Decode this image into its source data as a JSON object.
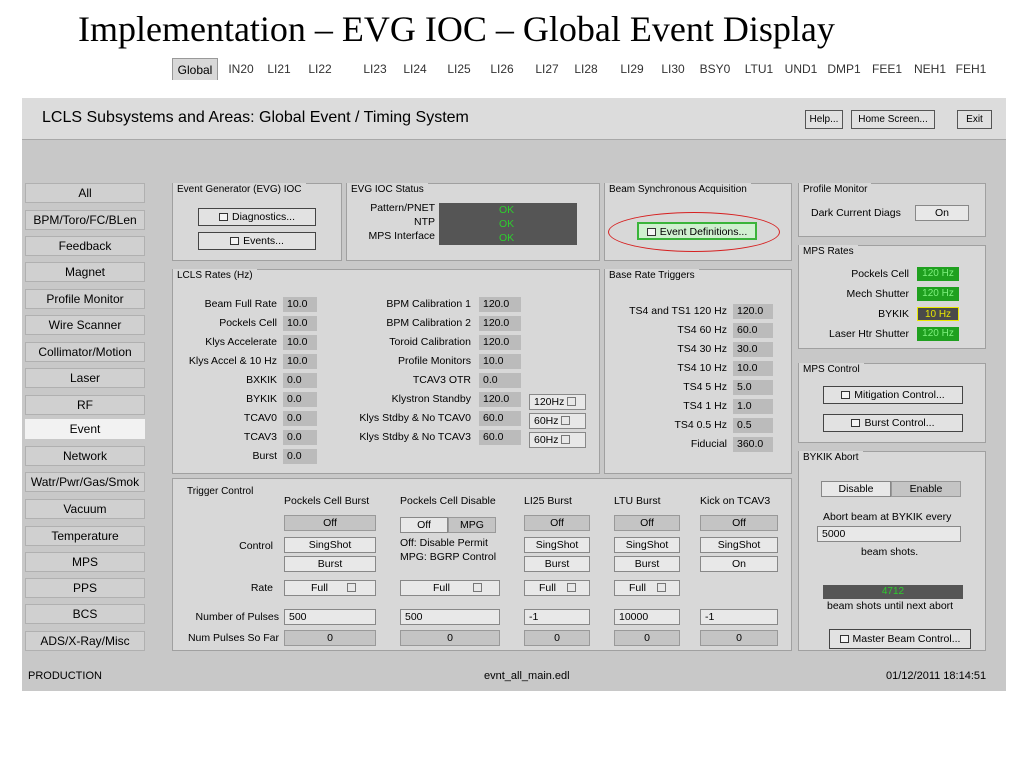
{
  "slide": {
    "title": "Implementation – EVG IOC – Global Event Display"
  },
  "app": {
    "title": "LCLS Subsystems and Areas: Global Event / Timing System",
    "help": "Help...",
    "home": "Home Screen...",
    "exit": "Exit"
  },
  "tabs": [
    "Global",
    "IN20",
    "LI21",
    "LI22",
    "LI23",
    "LI24",
    "LI25",
    "LI26",
    "LI27",
    "LI28",
    "LI29",
    "LI30",
    "BSY0",
    "LTU1",
    "UND1",
    "DMP1",
    "FEE1",
    "NEH1",
    "FEH1"
  ],
  "nav": [
    "All",
    "BPM/Toro/FC/BLen",
    "Feedback",
    "Magnet",
    "Profile Monitor",
    "Wire Scanner",
    "Collimator/Motion",
    "Laser",
    "RF",
    "Event",
    "Network",
    "Watr/Pwr/Gas/Smok",
    "Vacuum",
    "Temperature",
    "MPS",
    "PPS",
    "BCS",
    "ADS/X-Ray/Misc"
  ],
  "evg": {
    "title": "Event Generator (EVG) IOC",
    "diagnostics": "Diagnostics...",
    "events": "Events..."
  },
  "evg_status": {
    "title": "EVG IOC Status",
    "pattern_label": "Pattern/PNET",
    "pattern_val": "OK",
    "ntp_label": "NTP",
    "ntp_val": "OK",
    "mps_label": "MPS Interface",
    "mps_val": "OK"
  },
  "bsa": {
    "title": "Beam Synchronous Acquisition",
    "event_def": "Event Definitions..."
  },
  "rates": {
    "title": "LCLS Rates (Hz)",
    "left": [
      {
        "label": "Beam Full Rate",
        "value": "10.0"
      },
      {
        "label": "Pockels Cell",
        "value": "10.0"
      },
      {
        "label": "Klys Accelerate",
        "value": "10.0"
      },
      {
        "label": "Klys Accel & 10 Hz",
        "value": "10.0"
      },
      {
        "label": "BXKIK",
        "value": "0.0"
      },
      {
        "label": "BYKIK",
        "value": "0.0"
      },
      {
        "label": "TCAV0",
        "value": "0.0"
      },
      {
        "label": "TCAV3",
        "value": "0.0"
      },
      {
        "label": "Burst",
        "value": "0.0"
      }
    ],
    "right": [
      {
        "label": "BPM Calibration 1",
        "value": "120.0"
      },
      {
        "label": "BPM Calibration 2",
        "value": "120.0"
      },
      {
        "label": "Toroid Calibration",
        "value": "120.0"
      },
      {
        "label": "Profile Monitors",
        "value": "10.0"
      },
      {
        "label": "TCAV3 OTR",
        "value": "0.0"
      },
      {
        "label": "Klystron Standby",
        "value": "120.0"
      },
      {
        "label": "Klys Stdby & No TCAV0",
        "value": "60.0"
      },
      {
        "label": "Klys Stdby & No TCAV3",
        "value": "60.0"
      }
    ],
    "menus": [
      "120Hz",
      "60Hz",
      "60Hz"
    ]
  },
  "base": {
    "title": "Base Rate Triggers",
    "rows": [
      {
        "label": "TS4 and TS1 120 Hz",
        "value": "120.0"
      },
      {
        "label": "TS4 60 Hz",
        "value": "60.0"
      },
      {
        "label": "TS4 30 Hz",
        "value": "30.0"
      },
      {
        "label": "TS4 10 Hz",
        "value": "10.0"
      },
      {
        "label": "TS4 5 Hz",
        "value": "5.0"
      },
      {
        "label": "TS4 1 Hz",
        "value": "1.0"
      },
      {
        "label": "TS4 0.5 Hz",
        "value": "0.5"
      },
      {
        "label": "Fiducial",
        "value": "360.0"
      }
    ]
  },
  "trig": {
    "title": "Trigger Control",
    "cols": [
      "Pockels Cell Burst",
      "Pockels Cell Disable",
      "LI25 Burst",
      "LTU Burst",
      "Kick on TCAV3"
    ],
    "control_label": "Control",
    "rate_label": "Rate",
    "npulse_label": "Number of Pulses",
    "sofar_label": "Num Pulses So Far",
    "off": "Off",
    "mpg": "MPG",
    "singshot": "SingShot",
    "burst": "Burst",
    "on": "On",
    "full": "Full",
    "disable1": "Off: Disable Permit",
    "disable2": "MPG: BGRP Control",
    "npulses": [
      "500",
      "500",
      "-1",
      "10000",
      "-1"
    ],
    "sofar": [
      "0",
      "0",
      "0",
      "0",
      "0"
    ]
  },
  "profile": {
    "title": "Profile Monitor",
    "dark_label": "Dark Current Diags",
    "dark_val": "On"
  },
  "mps_rates": {
    "title": "MPS Rates",
    "rows": [
      {
        "label": "Pockels Cell",
        "value": "120 Hz"
      },
      {
        "label": "Mech Shutter",
        "value": "120 Hz"
      },
      {
        "label": "BYKIK",
        "value": "10 Hz"
      },
      {
        "label": "Laser Htr Shutter",
        "value": "120 Hz"
      }
    ]
  },
  "mps_ctrl": {
    "title": "MPS Control",
    "mitigation": "Mitigation Control...",
    "burst": "Burst Control..."
  },
  "bykik": {
    "title": "BYKIK Abort",
    "disable": "Disable",
    "enable": "Enable",
    "abort_text": "Abort beam at BYKIK every",
    "every": "5000",
    "beam_shots": "beam shots.",
    "count": "4712",
    "until": "beam shots until next abort",
    "master": "Master Beam Control..."
  },
  "statusbar": {
    "left": "PRODUCTION",
    "center": "evnt_all_main.edl",
    "right": "01/12/2011 18:14:51"
  },
  "colors": {
    "ok": "#2ecc2e",
    "rate_green": "#1fa01f",
    "rate_yellow": "#e8e800",
    "annotation": "#d62020"
  }
}
